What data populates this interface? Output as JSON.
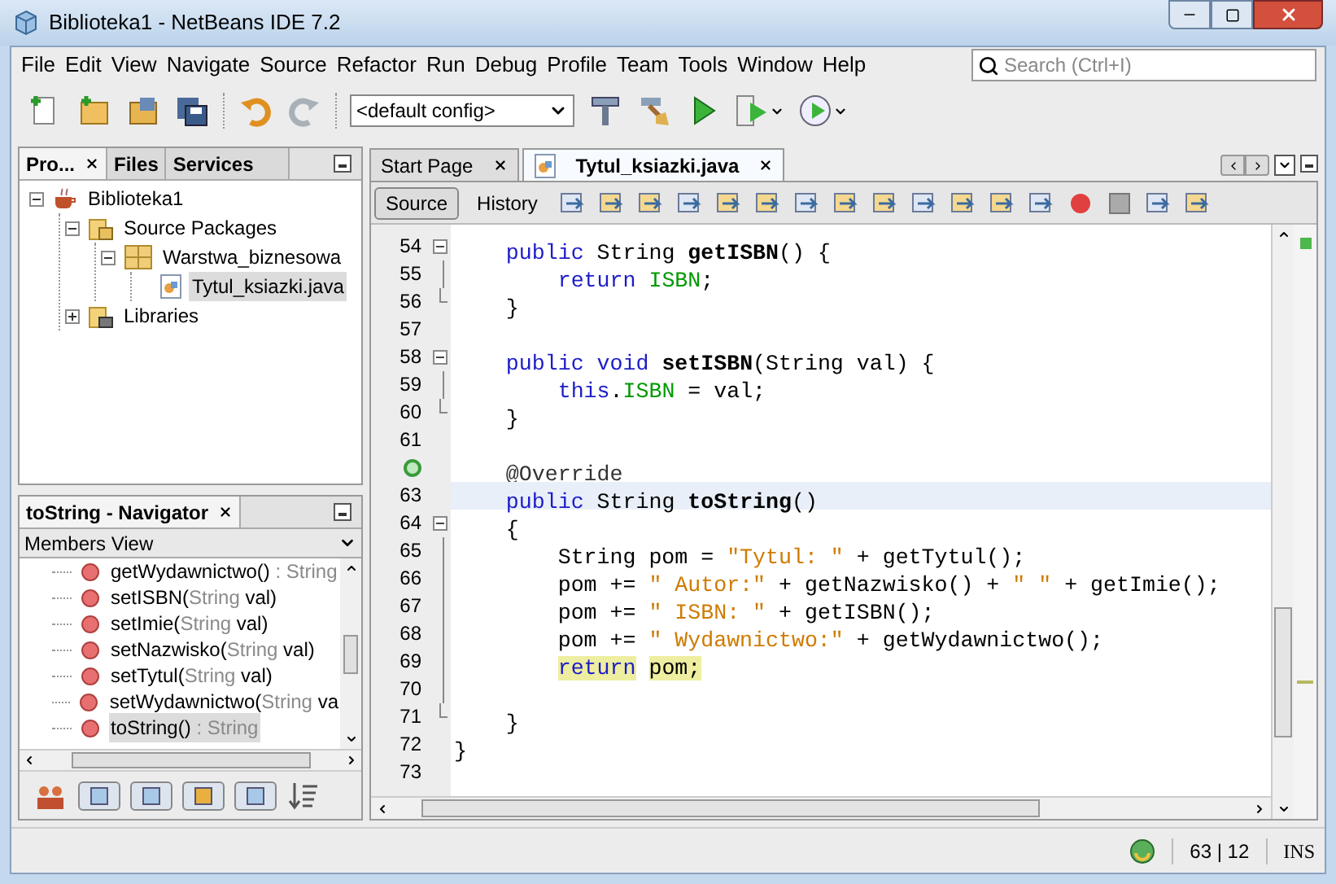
{
  "window": {
    "title": "Biblioteka1 - NetBeans IDE 7.2"
  },
  "menu": [
    "File",
    "Edit",
    "View",
    "Navigate",
    "Source",
    "Refactor",
    "Run",
    "Debug",
    "Profile",
    "Team",
    "Tools",
    "Window",
    "Help"
  ],
  "search": {
    "placeholder": "Search (Ctrl+I)"
  },
  "toolbar": {
    "config": "<default config>"
  },
  "projects_panel": {
    "tabs": [
      {
        "label": "Pro...",
        "selected": true
      },
      {
        "label": "Files",
        "selected": false
      },
      {
        "label": "Services",
        "selected": false
      }
    ],
    "tree": [
      {
        "label": "Biblioteka1",
        "kind": "project",
        "expanded": true,
        "selected": false,
        "children": [
          {
            "label": "Source Packages",
            "kind": "sources",
            "expanded": true,
            "selected": false,
            "children": [
              {
                "label": "Warstwa_biznesowa",
                "kind": "package",
                "expanded": true,
                "selected": false,
                "children": [
                  {
                    "label": "Tytul_ksiazki.java",
                    "kind": "java",
                    "selected": true
                  }
                ]
              }
            ]
          },
          {
            "label": "Libraries",
            "kind": "libraries",
            "expanded": false,
            "selected": false
          }
        ]
      }
    ]
  },
  "navigator": {
    "title": "toString - Navigator",
    "view": "Members View",
    "members": [
      {
        "parts": [
          {
            "text": "getWydawnictwo()",
            "muted": false
          },
          {
            "text": " : String",
            "muted": true
          }
        ],
        "selected": false
      },
      {
        "parts": [
          {
            "text": "setISBN(",
            "muted": false
          },
          {
            "text": "String",
            "muted": true
          },
          {
            "text": " val)",
            "muted": false
          }
        ],
        "selected": false
      },
      {
        "parts": [
          {
            "text": "setImie(",
            "muted": false
          },
          {
            "text": "String",
            "muted": true
          },
          {
            "text": " val)",
            "muted": false
          }
        ],
        "selected": false
      },
      {
        "parts": [
          {
            "text": "setNazwisko(",
            "muted": false
          },
          {
            "text": "String",
            "muted": true
          },
          {
            "text": " val)",
            "muted": false
          }
        ],
        "selected": false
      },
      {
        "parts": [
          {
            "text": "setTytul(",
            "muted": false
          },
          {
            "text": "String",
            "muted": true
          },
          {
            "text": " val)",
            "muted": false
          }
        ],
        "selected": false
      },
      {
        "parts": [
          {
            "text": "setWydawnictwo(",
            "muted": false
          },
          {
            "text": "String",
            "muted": true
          },
          {
            "text": " va",
            "muted": false
          }
        ],
        "selected": false
      },
      {
        "parts": [
          {
            "text": "toString()",
            "muted": false
          },
          {
            "text": " : String",
            "muted": true
          }
        ],
        "selected": true
      }
    ]
  },
  "editor": {
    "tabs": [
      {
        "label": "Start Page",
        "selected": false
      },
      {
        "label": "Tytul_ksiazki.java",
        "selected": true
      }
    ],
    "views": [
      {
        "label": "Source",
        "selected": true
      },
      {
        "label": "History",
        "selected": false
      }
    ],
    "lines": [
      {
        "number": "54",
        "kind": "fold_start",
        "override": false,
        "current": false,
        "tokens": [
          {
            "text": "    public",
            "kind": "keyword"
          },
          {
            "text": " String ",
            "kind": "plain"
          },
          {
            "text": "getISBN",
            "kind": "method"
          },
          {
            "text": "() {",
            "kind": "plain"
          }
        ]
      },
      {
        "number": "55",
        "kind": "fold_body",
        "override": false,
        "current": false,
        "tokens": [
          {
            "text": "        return",
            "kind": "keyword"
          },
          {
            "text": " ISBN",
            "kind": "field"
          },
          {
            "text": ";",
            "kind": "plain"
          }
        ]
      },
      {
        "number": "56",
        "kind": "fold_end",
        "override": false,
        "current": false,
        "tokens": [
          {
            "text": "    }",
            "kind": "plain"
          }
        ]
      },
      {
        "number": "57",
        "kind": "plain",
        "override": false,
        "current": false
      },
      {
        "number": "58",
        "kind": "fold_start",
        "override": false,
        "current": false,
        "tokens": [
          {
            "text": "    public void",
            "kind": "keyword"
          },
          {
            "text": " setISBN",
            "kind": "method"
          },
          {
            "text": "(String val) {",
            "kind": "plain"
          }
        ]
      },
      {
        "number": "59",
        "kind": "fold_body",
        "override": false,
        "current": false,
        "tokens": [
          {
            "text": "        this",
            "kind": "keyword"
          },
          {
            "text": ".",
            "kind": "plain"
          },
          {
            "text": "ISBN",
            "kind": "field"
          },
          {
            "text": " = val;",
            "kind": "plain"
          }
        ]
      },
      {
        "number": "60",
        "kind": "fold_end",
        "override": false,
        "current": false,
        "tokens": [
          {
            "text": "    }",
            "kind": "plain"
          }
        ]
      },
      {
        "number": "61",
        "kind": "plain",
        "override": false,
        "current": false
      },
      {
        "kind": "plain",
        "override": true,
        "current": false,
        "tokens": [
          {
            "text": "    @Override",
            "kind": "annotation"
          }
        ]
      },
      {
        "number": "63",
        "kind": "plain",
        "override": false,
        "current": true,
        "tokens": [
          {
            "text": "    public",
            "kind": "keyword"
          },
          {
            "text": " String ",
            "kind": "plain"
          },
          {
            "text": "toString",
            "kind": "method"
          },
          {
            "text": "()",
            "kind": "plain"
          }
        ]
      },
      {
        "number": "64",
        "kind": "fold_start",
        "override": false,
        "current": false,
        "tokens": [
          {
            "text": "    {",
            "kind": "plain"
          }
        ]
      },
      {
        "number": "65",
        "kind": "fold_body",
        "override": false,
        "current": false,
        "tokens": [
          {
            "text": "        String pom = ",
            "kind": "plain"
          },
          {
            "text": "\"Tytul: \"",
            "kind": "string"
          },
          {
            "text": " + getTytul();",
            "kind": "plain"
          }
        ]
      },
      {
        "number": "66",
        "kind": "fold_body",
        "override": false,
        "current": false,
        "tokens": [
          {
            "text": "        pom += ",
            "kind": "plain"
          },
          {
            "text": "\" Autor:\"",
            "kind": "string"
          },
          {
            "text": " + getNazwisko() + ",
            "kind": "plain"
          },
          {
            "text": "\" \"",
            "kind": "string"
          },
          {
            "text": " + getImie();",
            "kind": "plain"
          }
        ]
      },
      {
        "number": "67",
        "kind": "fold_body",
        "override": false,
        "current": false,
        "tokens": [
          {
            "text": "        pom += ",
            "kind": "plain"
          },
          {
            "text": "\" ISBN: \"",
            "kind": "string"
          },
          {
            "text": " + getISBN();",
            "kind": "plain"
          }
        ]
      },
      {
        "number": "68",
        "kind": "fold_body",
        "override": false,
        "current": false,
        "tokens": [
          {
            "text": "        pom += ",
            "kind": "plain"
          },
          {
            "text": "\" Wydawnictwo:\"",
            "kind": "string"
          },
          {
            "text": " + getWydawnictwo();",
            "kind": "plain"
          }
        ]
      },
      {
        "number": "69",
        "kind": "fold_body",
        "override": false,
        "current": false,
        "tokens": [
          {
            "text": "        return",
            "kind": "keyword",
            "marked": true
          },
          {
            "text": " pom;",
            "kind": "plain",
            "marked": true
          }
        ]
      },
      {
        "number": "70",
        "kind": "fold_body",
        "override": false,
        "current": false
      },
      {
        "number": "71",
        "kind": "fold_end",
        "override": false,
        "current": false,
        "tokens": [
          {
            "text": "    }",
            "kind": "plain"
          }
        ]
      },
      {
        "number": "72",
        "kind": "plain",
        "override": false,
        "current": false,
        "tokens": [
          {
            "text": "}",
            "kind": "plain"
          }
        ]
      },
      {
        "number": "73",
        "kind": "plain",
        "override": false,
        "current": false
      }
    ]
  },
  "status_bar": {
    "position": "63 | 12",
    "mode": "INS"
  }
}
